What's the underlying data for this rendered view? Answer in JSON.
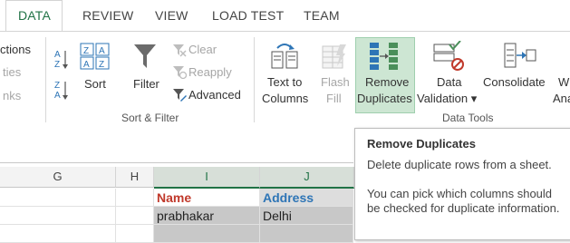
{
  "tabs": [
    "DATA",
    "REVIEW",
    "VIEW",
    "LOAD TEST",
    "TEAM"
  ],
  "active_tab": "DATA",
  "left_partial": [
    "ctions",
    "ties",
    "nks"
  ],
  "sort_filter": {
    "sort_label": "Sort",
    "filter_label": "Filter",
    "clear_label": "Clear",
    "reapply_label": "Reapply",
    "advanced_label": "Advanced",
    "group_label": "Sort & Filter"
  },
  "data_tools": {
    "text_to_columns": [
      "Text to",
      "Columns"
    ],
    "flash_fill": [
      "Flash",
      "Fill"
    ],
    "remove_duplicates": [
      "Remove",
      "Duplicates"
    ],
    "data_validation": [
      "Data",
      "Validation ▾"
    ],
    "consolidate_label": "Consolidate",
    "what_if_partial": [
      "W",
      "Ana"
    ],
    "group_label": "Data Tools"
  },
  "sheet": {
    "columns": [
      "G",
      "H",
      "I",
      "J"
    ],
    "rows": [
      [
        "",
        "",
        "Name",
        "Address"
      ],
      [
        "",
        "",
        "prabhakar",
        "Delhi"
      ]
    ]
  },
  "tooltip": {
    "title": "Remove Duplicates",
    "line1": "Delete duplicate rows from a sheet.",
    "line2": "You can pick which columns should be checked for duplicate information."
  },
  "colors": {
    "accent": "#217346",
    "header_red": "#c0392b",
    "header_blue": "#2e75b6"
  }
}
